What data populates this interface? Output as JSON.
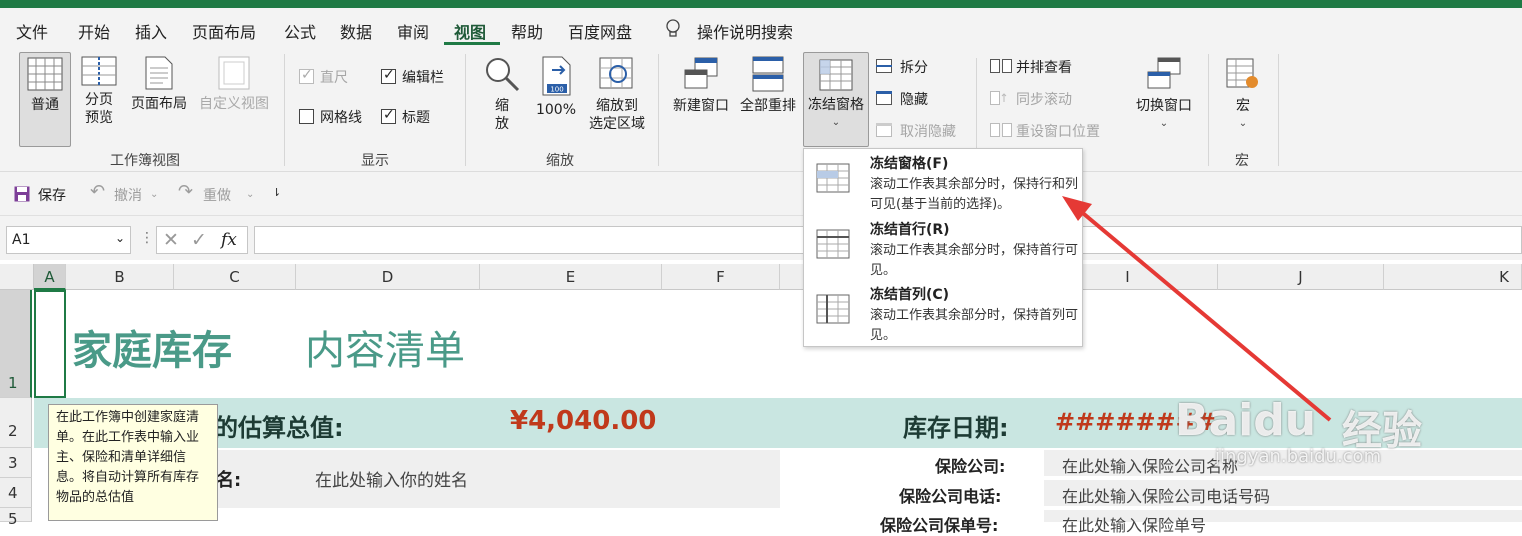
{
  "colors": {
    "accent": "#1f7a45",
    "title_teal": "#4a9a88",
    "value_red": "#c0391b",
    "band": "#c9e6e1"
  },
  "menu": {
    "tabs": [
      "文件",
      "开始",
      "插入",
      "页面布局",
      "公式",
      "数据",
      "审阅",
      "视图",
      "帮助",
      "百度网盘"
    ],
    "active": "视图",
    "tell_me": "操作说明搜索"
  },
  "ribbon": {
    "workbook_views": {
      "label": "工作簿视图",
      "normal": "普通",
      "page_break_1": "分页",
      "page_break_2": "预览",
      "page_layout": "页面布局",
      "custom_views": "自定义视图"
    },
    "show": {
      "label": "显示",
      "ruler": "直尺",
      "formula_bar": "编辑栏",
      "gridlines": "网格线",
      "headings": "标题"
    },
    "zoom": {
      "label": "缩放",
      "zoom_1": "缩",
      "zoom_2": "放",
      "hundred": "100%",
      "to_sel_1": "缩放到",
      "to_sel_2": "选定区域",
      "hundred_icon_text": "100"
    },
    "window": {
      "new_window": "新建窗口",
      "arrange_all": "全部重排",
      "freeze_panes": "冻结窗格",
      "split": "拆分",
      "hide": "隐藏",
      "unhide": "取消隐藏",
      "side_by_side": "并排查看",
      "sync_scroll": "同步滚动",
      "reset_position": "重设窗口位置",
      "switch_windows": "切换窗口"
    },
    "macros": {
      "label": "宏",
      "button": "宏"
    }
  },
  "qat": {
    "save": "保存",
    "undo": "撤消",
    "redo": "重做"
  },
  "formula_bar": {
    "name_box": "A1",
    "fx": "fx",
    "value": ""
  },
  "columns": [
    "A",
    "B",
    "C",
    "D",
    "E",
    "F",
    "G",
    "H",
    "I",
    "J",
    "K"
  ],
  "rows": [
    "1",
    "2",
    "3",
    "4",
    "5"
  ],
  "sheet": {
    "title_main": "家庭库存",
    "title_sub": "内容清单",
    "estimate_label": "的估算总值:",
    "estimate_value": "¥4,040.00",
    "date_label": "库存日期:",
    "date_value": "########",
    "name_label": "名:",
    "name_placeholder": "在此处输入你的姓名",
    "ins_company_label": "保险公司:",
    "ins_company_value": "在此处输入保险公司名称",
    "ins_phone_label": "保险公司电话:",
    "ins_phone_value": "在此处输入保险公司电话号码",
    "ins_policy_label": "保险公司保单号:",
    "ins_policy_value": "在此处输入保险单号"
  },
  "tooltip": "在此工作簿中创建家庭清单。在此工作表中输入业主、保险和清单详细信息。将自动计算所有库存物品的总估值",
  "dropdown": [
    {
      "title": "冻结窗格(F)",
      "desc": "滚动工作表其余部分时，保持行和列可见(基于当前的选择)。"
    },
    {
      "title": "冻结首行(R)",
      "desc": "滚动工作表其余部分时，保持首行可见。"
    },
    {
      "title": "冻结首列(C)",
      "desc": "滚动工作表其余部分时，保持首列可见。"
    }
  ],
  "watermark": {
    "brand": "Baidu",
    "brand_cn": "经验",
    "url": "jingyan.baidu.com"
  }
}
